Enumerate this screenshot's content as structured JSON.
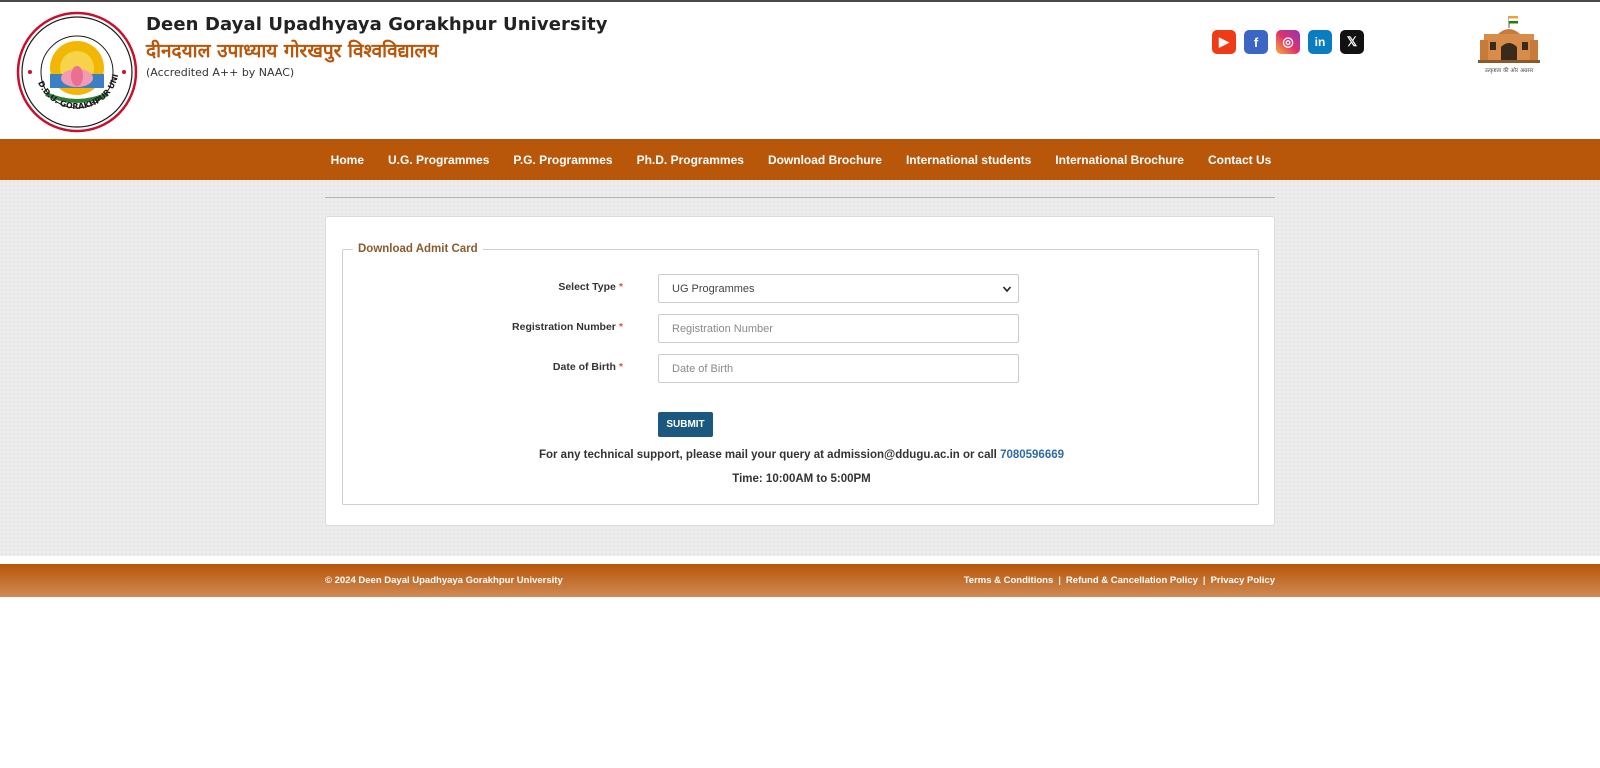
{
  "header": {
    "title_en": "Deen Dayal Upadhyaya Gorakhpur University",
    "title_hi": "दीनदयाल उपाध्याय गोरखपुर विश्वविद्यालय",
    "accreditation": "(Accredited A++ by NAAC)",
    "logo_text": "D.D.U. GORAKHPUR UNIVERSITY",
    "gate_caption": "उत्कृष्टता की ओर अग्रसर",
    "socials": [
      {
        "name": "youtube-icon",
        "glyph": "▶"
      },
      {
        "name": "facebook-icon",
        "glyph": "f"
      },
      {
        "name": "instagram-icon",
        "glyph": "◎"
      },
      {
        "name": "linkedin-icon",
        "glyph": "in"
      },
      {
        "name": "x-icon",
        "glyph": "𝕏"
      }
    ]
  },
  "nav": {
    "items": [
      "Home",
      "U.G. Programmes",
      "P.G. Programmes",
      "Ph.D. Programmes",
      "Download Brochure",
      "International students",
      "International Brochure",
      "Contact Us"
    ]
  },
  "form": {
    "legend": "Download Admit Card",
    "select_type_label": "Select Type",
    "select_type_value": "UG Programmes",
    "reg_label": "Registration Number",
    "reg_placeholder": "Registration Number",
    "dob_label": "Date of Birth",
    "dob_placeholder": "Date of Birth",
    "required_mark": "*",
    "submit_label": "SUBMIT"
  },
  "support": {
    "text": "For any technical support, please mail your query at admission@ddugu.ac.in or call",
    "phone": "7080596669",
    "time": "Time: 10:00AM to 5:00PM"
  },
  "footer": {
    "copyright": "© 2024 Deen Dayal Upadhyaya Gorakhpur University",
    "links": [
      "Terms & Conditions",
      "Refund & Cancellation Policy",
      "Privacy Policy"
    ],
    "separator": "|"
  },
  "colors": {
    "brand_orange": "#b8560a",
    "submit_blue": "#1b587f",
    "phone_link": "#2f6aa3"
  }
}
